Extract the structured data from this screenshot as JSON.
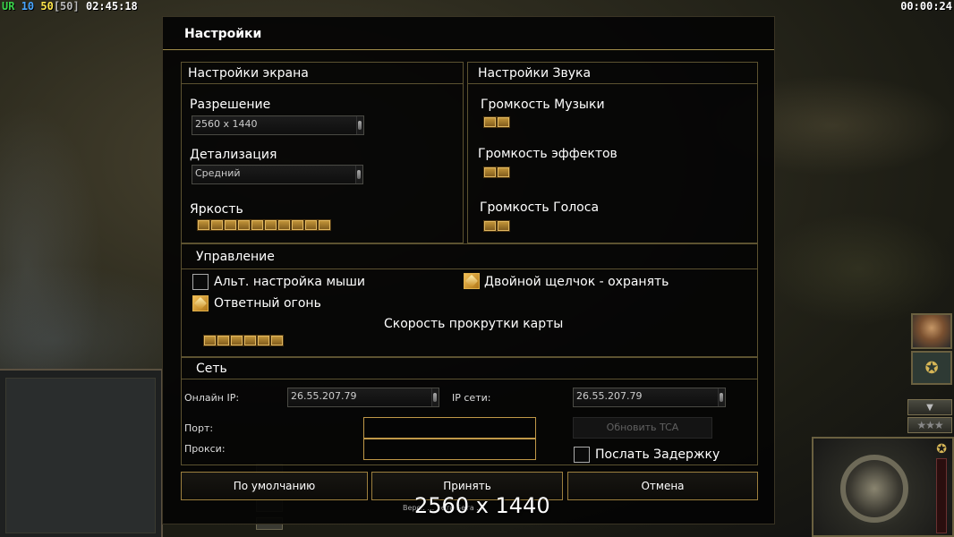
{
  "hud": {
    "faction": "UR",
    "num_a": "10",
    "num_b": "50",
    "num_c": "[50]",
    "clock": "02:45:18",
    "timer": "00:00:24"
  },
  "dialog": {
    "title": "Настройки",
    "screen": {
      "header": "Настройки экрана",
      "resolution_label": "Разрешение",
      "resolution_value": "2560 x 1440",
      "detail_label": "Детализация",
      "detail_value": "Средний",
      "brightness_label": "Яркость",
      "brightness_level": 10,
      "brightness_max": 10
    },
    "sound": {
      "header": "Настройки Звука",
      "music_label": "Громкость Музыки",
      "music_level": 2,
      "effects_label": "Громкость эффектов",
      "effects_level": 2,
      "voice_label": "Громкость Голоса",
      "voice_level": 2
    },
    "controls": {
      "header": "Управление",
      "alt_mouse_label": "Альт. настройка мыши",
      "alt_mouse_checked": false,
      "double_click_label": "Двойной щелчок - охранять",
      "double_click_checked": true,
      "return_fire_label": "Ответный огонь",
      "return_fire_checked": true,
      "scroll_speed_label": "Скорость прокрутки карты",
      "scroll_speed_level": 6
    },
    "network": {
      "header": "Сеть",
      "online_ip_label": "Онлайн IP:",
      "online_ip_value": "26.55.207.79",
      "lan_ip_label": "IP сети:",
      "lan_ip_value": "26.55.207.79",
      "port_label": "Порт:",
      "port_value": "",
      "proxy_label": "Прокси:",
      "proxy_value": "",
      "update_tca_label": "Обновить TCA",
      "send_delay_label": "Послать Задержку",
      "send_delay_checked": false
    },
    "buttons": {
      "default": "По умолчанию",
      "accept": "Принять",
      "cancel": "Отмена"
    },
    "version_text": "Верс..  ...  ..ета  Бета ..."
  },
  "overlay_resolution": "2560 x 1440",
  "colors": {
    "accent_gold": "#c89a3c",
    "border_gold": "#9c7f3e",
    "panel_bg": "#040404"
  }
}
